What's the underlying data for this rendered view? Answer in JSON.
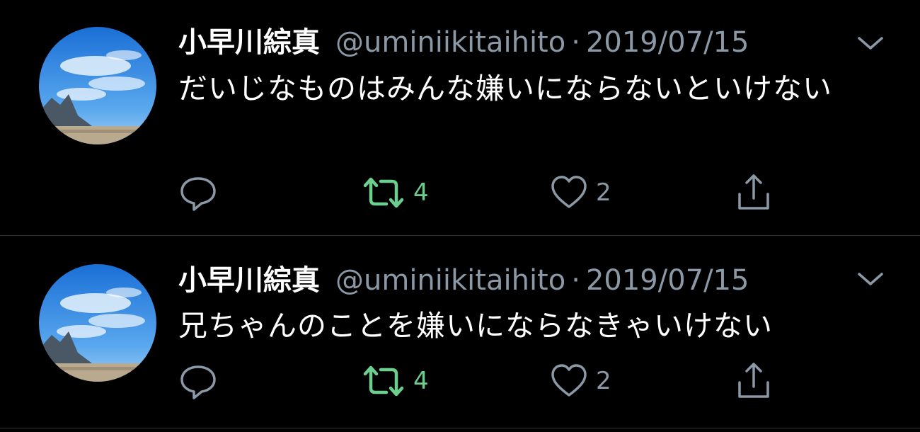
{
  "colors": {
    "background": "#000000",
    "text": "#ffffff",
    "muted": "#8b98a5",
    "retweet_active": "#6ccf8e",
    "divider": "#2f3336"
  },
  "icons": {
    "reply": "speech-bubble-icon",
    "retweet": "retweet-arrows-icon",
    "like": "heart-icon",
    "share": "share-upload-icon",
    "more": "chevron-down-icon"
  },
  "tweets": [
    {
      "display_name": "小早川綜真",
      "handle": "@uminiikitaihito",
      "separator": "·",
      "date": "2019/07/15",
      "text": "だいじなものはみんな嫌いにならないといけない",
      "retweet_count": "4",
      "like_count": "2"
    },
    {
      "display_name": "小早川綜真",
      "handle": "@uminiikitaihito",
      "separator": "·",
      "date": "2019/07/15",
      "text": "兄ちゃんのことを嫌いにならなきゃいけない",
      "retweet_count": "4",
      "like_count": "2"
    }
  ]
}
